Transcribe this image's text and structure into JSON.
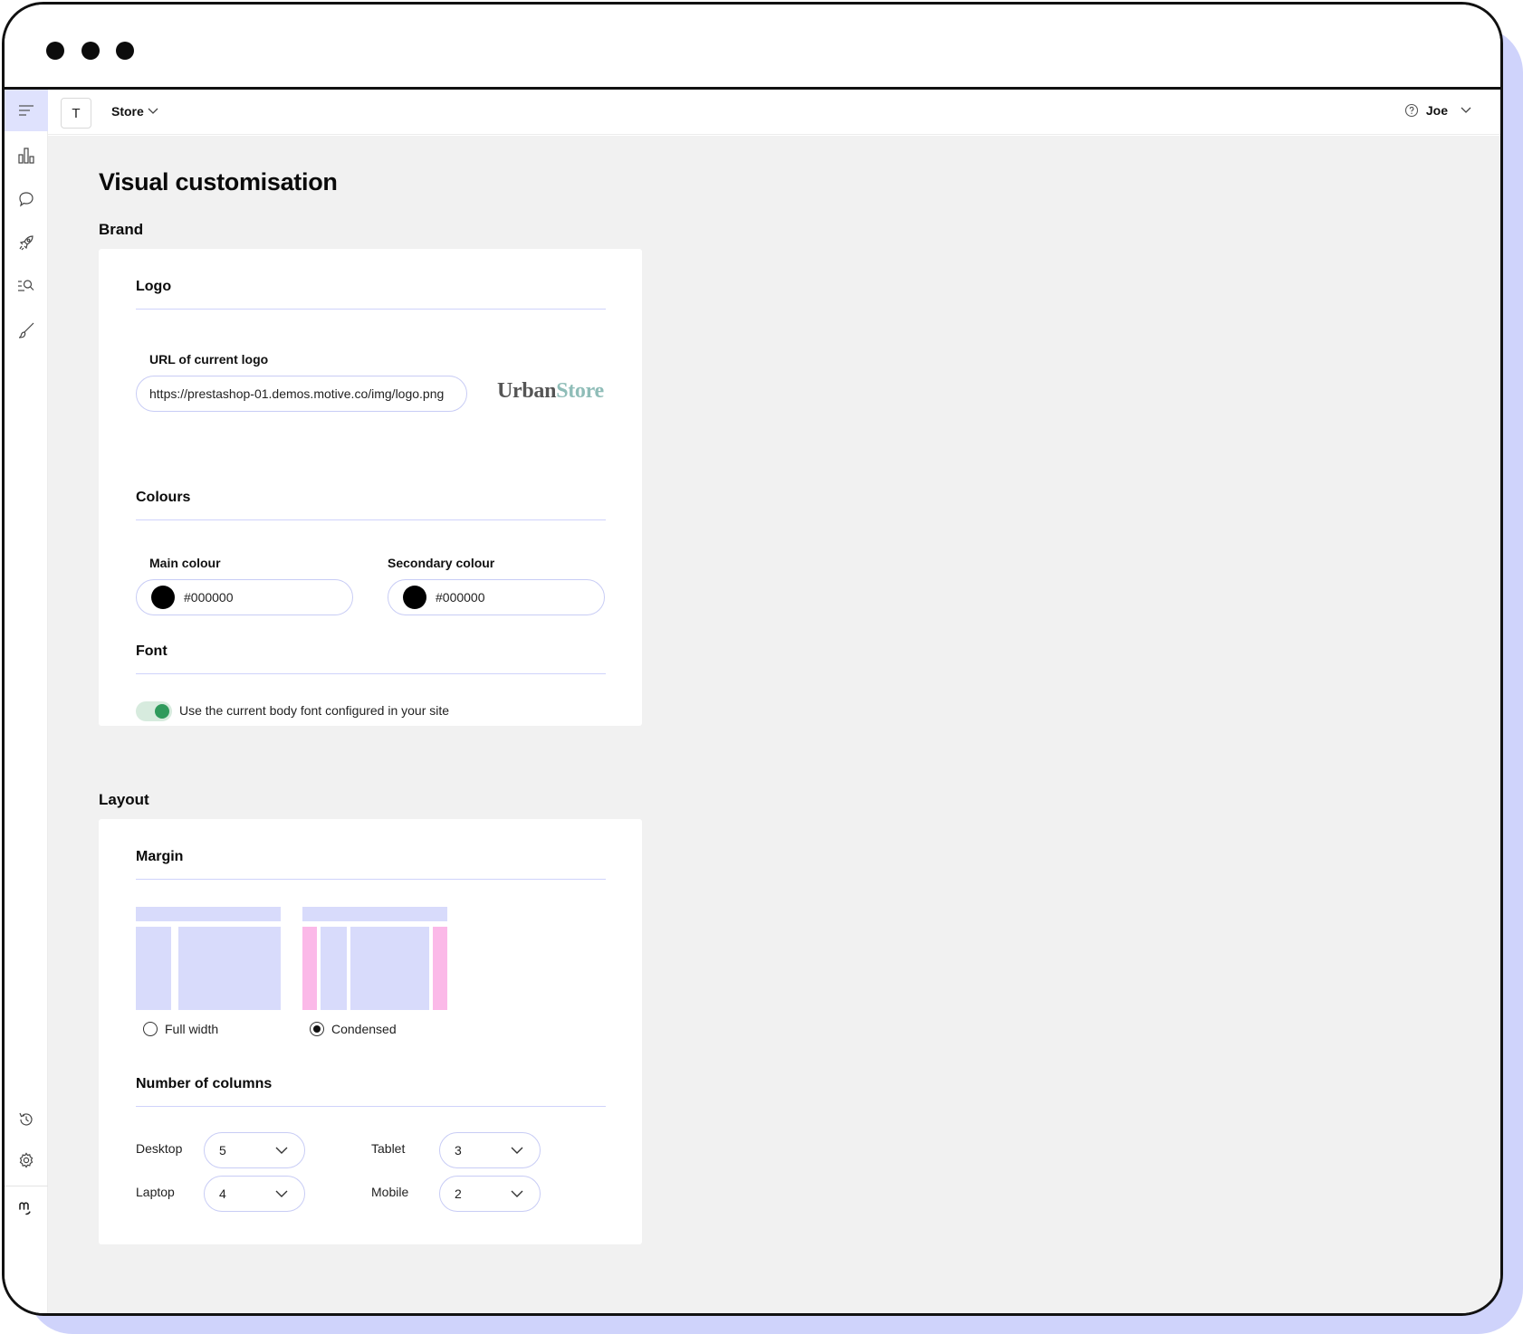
{
  "window": {
    "controls": [
      "close-dot",
      "minimize-dot",
      "zoom-dot"
    ]
  },
  "topbar": {
    "store_badge": "T",
    "store_label": "Store",
    "user_name": "Joe"
  },
  "sidebar": {
    "icons": [
      "menu-icon",
      "chart-icon",
      "chat-icon",
      "rocket-icon",
      "search-list-icon",
      "brush-icon",
      "history-icon",
      "gear-icon",
      "brand-logo-icon"
    ]
  },
  "page": {
    "title": "Visual customisation",
    "brand_section": "Brand",
    "layout_section": "Layout"
  },
  "brand": {
    "logo": {
      "title": "Logo",
      "url_label": "URL of current logo",
      "url_value": "https://prestashop-01.demos.motive.co/img/logo.png",
      "preview_part1": "Urban",
      "preview_part2": "Store",
      "preview_color1": "#555555",
      "preview_color2": "#8fbdb8"
    },
    "colours": {
      "title": "Colours",
      "main_label": "Main colour",
      "main_value": "#000000",
      "secondary_label": "Secondary colour",
      "secondary_value": "#000000"
    },
    "font": {
      "title": "Font",
      "toggle_label": "Use the current body font configured in your site",
      "toggle_on": true
    }
  },
  "layout": {
    "margin": {
      "title": "Margin",
      "options": [
        {
          "label": "Full width",
          "selected": false
        },
        {
          "label": "Condensed",
          "selected": true
        }
      ]
    },
    "columns": {
      "title": "Number of columns",
      "desktop_label": "Desktop",
      "desktop_value": "5",
      "laptop_label": "Laptop",
      "laptop_value": "4",
      "tablet_label": "Tablet",
      "tablet_value": "3",
      "mobile_label": "Mobile",
      "mobile_value": "2"
    }
  },
  "colors": {
    "accent_light": "#dfe2fd",
    "shadow": "#cfd3fb",
    "toggle_on": "#2f9a5c",
    "margin_highlight": "#fbb9e8"
  }
}
